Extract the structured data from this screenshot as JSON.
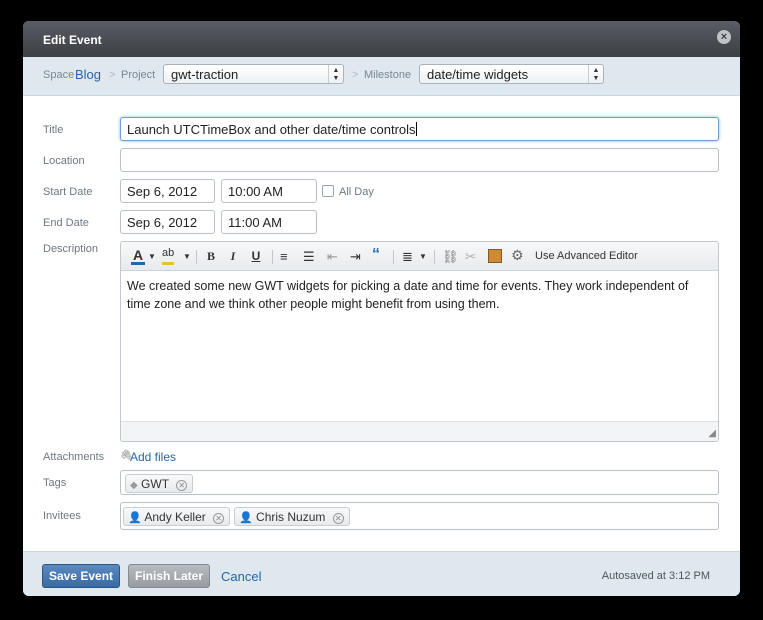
{
  "dialog": {
    "title": "Edit Event"
  },
  "breadcrumb": {
    "space_label": "Space",
    "space_value": "Blog",
    "sep1": ">",
    "project_label": "Project",
    "project_value": "gwt-traction",
    "sep2": ">",
    "milestone_label": "Milestone",
    "milestone_value": "date/time widgets"
  },
  "form": {
    "title_label": "Title",
    "title_value": "Launch UTCTimeBox and other date/time controls",
    "location_label": "Location",
    "location_value": "",
    "start_label": "Start Date",
    "start_date": "Sep 6, 2012",
    "start_time": "10:00 AM",
    "allday_label": "All Day",
    "end_label": "End Date",
    "end_date": "Sep 6, 2012",
    "end_time": "11:00 AM",
    "description_label": "Description",
    "description_text": "We created some new GWT widgets for picking a date and time for events. They work independent of time zone and we think other people might benefit from using them.",
    "attachments_label": "Attachments",
    "add_files": "Add files",
    "tags_label": "Tags",
    "tags": [
      "GWT"
    ],
    "invitees_label": "Invitees",
    "invitees": [
      "Andy Keller",
      "Chris Nuzum"
    ]
  },
  "editor_toolbar": {
    "font_color": "A",
    "highlight": "ab",
    "bold": "B",
    "italic": "I",
    "underline": "U",
    "advanced_editor": "Use Advanced Editor"
  },
  "footer": {
    "save": "Save Event",
    "finish_later": "Finish Later",
    "cancel": "Cancel",
    "autosave": "Autosaved at 3:12 PM"
  },
  "colors": {
    "link": "#2466a7",
    "primary_button": "#3a6aa3",
    "header_bg": "#dfe7ef"
  }
}
